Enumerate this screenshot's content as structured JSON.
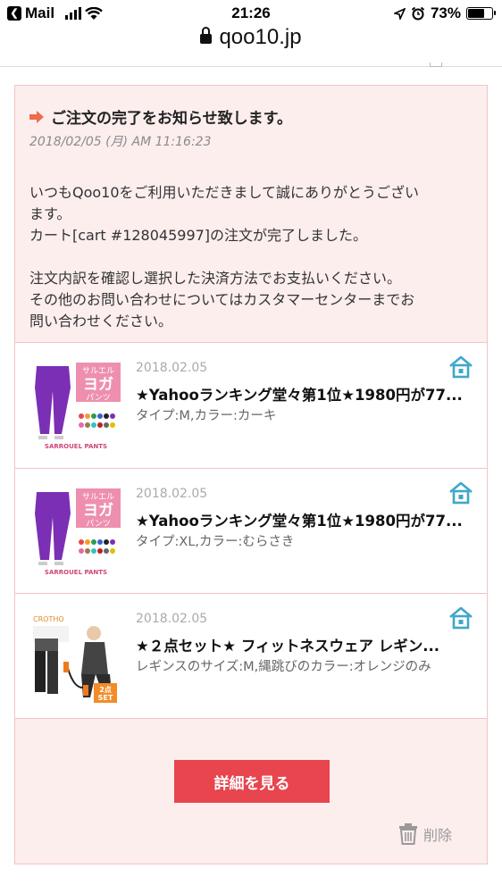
{
  "status_bar": {
    "back_app": "Mail",
    "time": "21:26",
    "battery": "73%",
    "battery_level": 0.73
  },
  "browser": {
    "url": "qoo10.jp"
  },
  "message": {
    "title": "ご注文の完了をお知らせ致します。",
    "date": "2018/02/05 (月) AM 11:16:23",
    "body_lines": [
      "いつもQoo10をご利用いただきまして誠にありがとうござい",
      "ます。",
      "カート[cart #128045997]の注文が完了しました。",
      "",
      "注文内訳を確認し選択した決済方法でお支払いください。",
      "その他のお問い合わせについてはカスタマーセンターまでお",
      "問い合わせください。"
    ]
  },
  "orders": [
    {
      "date": "2018.02.05",
      "name": "★Yahooランキング堂々第1位★1980円が77...",
      "options": "タイプ:M,カラー:カーキ",
      "thumb_text": [
        "サルエル",
        "ヨガ",
        "パンツ",
        "SARROUEL PANTS"
      ],
      "thumb_kind": "pants"
    },
    {
      "date": "2018.02.05",
      "name": "★Yahooランキング堂々第1位★1980円が77...",
      "options": "タイプ:XL,カラー:むらさき",
      "thumb_text": [
        "サルエル",
        "ヨガ",
        "パンツ",
        "SARROUEL PANTS"
      ],
      "thumb_kind": "pants"
    },
    {
      "date": "2018.02.05",
      "name": "★２点セット★ フィットネスウェア レギン...",
      "options": "レギンスのサイズ:M,縄跳びのカラー:オレンジのみ",
      "thumb_text": [
        "CROTHO",
        "2点",
        "SET"
      ],
      "thumb_kind": "fitness"
    }
  ],
  "actions": {
    "detail_label": "詳細を見る",
    "delete_label": "削除"
  },
  "colors": {
    "accent": "#e8454e",
    "arrow": "#f06b4b",
    "card_bg": "#fdeeee",
    "card_border": "#f2c4c4",
    "shop_icon": "#3fa7c9",
    "thumb_pants": "#7b2fb5"
  },
  "icons": {
    "back": "back-chevron-icon",
    "location": "location-arrow-icon",
    "alarm": "alarm-icon",
    "lock": "lock-icon",
    "shop": "shop-house-icon",
    "trash": "trash-icon",
    "arrow": "right-arrow-icon"
  }
}
